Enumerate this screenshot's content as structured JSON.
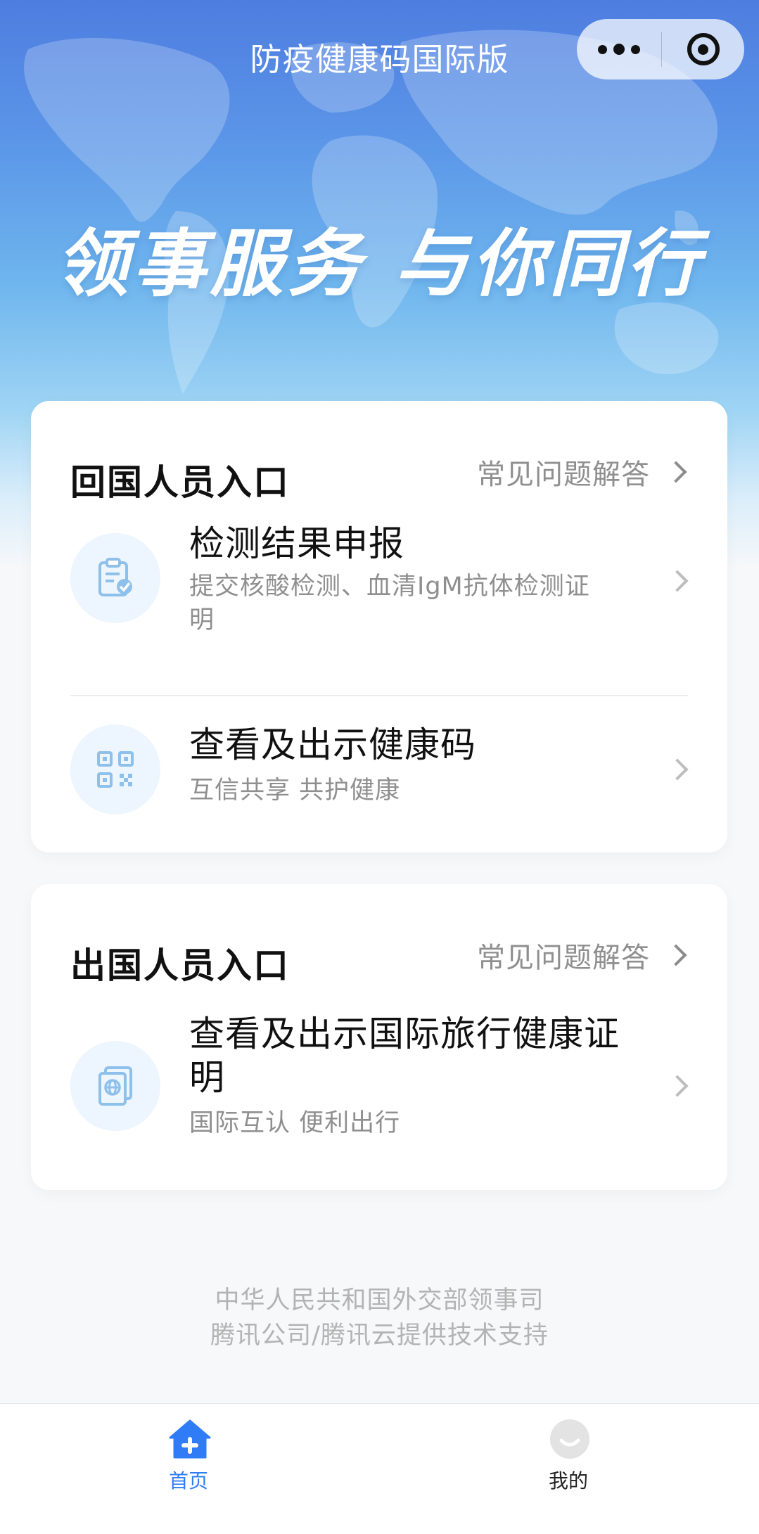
{
  "nav": {
    "title": "防疫健康码国际版",
    "more_icon": "more-dots-icon",
    "close_icon": "miniprogram-close-icon"
  },
  "hero": {
    "slogan": "领事服务 与你同行"
  },
  "returning": {
    "title": "回国人员入口",
    "faq_label": "常见问题解答",
    "items": [
      {
        "title": "检测结果申报",
        "subtitle": "提交核酸检测、血清IgM抗体检测证明",
        "icon": "clipboard-check-icon"
      },
      {
        "title": "查看及出示健康码",
        "subtitle": "互信共享 共护健康",
        "icon": "qr-code-icon"
      }
    ]
  },
  "departing": {
    "title": "出国人员入口",
    "faq_label": "常见问题解答",
    "items": [
      {
        "title": "查看及出示国际旅行健康证明",
        "subtitle": "国际互认 便利出行",
        "icon": "passport-icon"
      }
    ]
  },
  "footer": {
    "line1": "中华人民共和国外交部领事司",
    "line2": "腾讯公司/腾讯云提供技术支持"
  },
  "tabbar": {
    "home_label": "首页",
    "mine_label": "我的",
    "active": "home"
  },
  "colors": {
    "accent": "#2f7cf6",
    "icon_tint": "#8ec0ec",
    "icon_bg": "#edf5fe"
  }
}
